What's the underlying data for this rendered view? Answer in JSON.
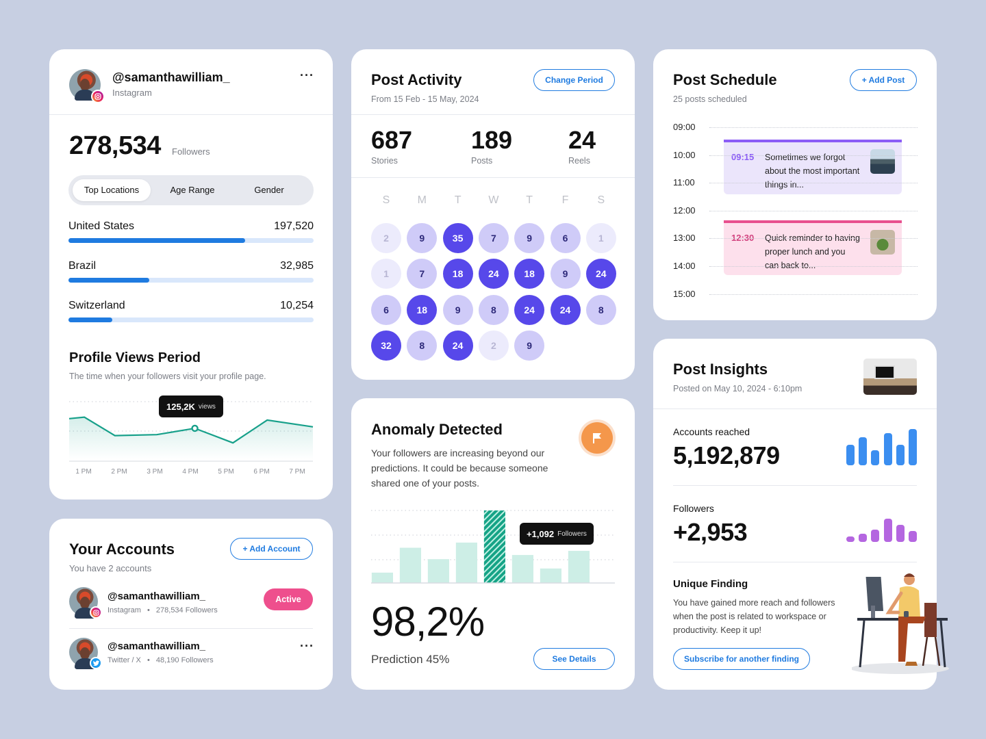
{
  "profile": {
    "handle": "@samanthawilliam_",
    "platform": "Instagram",
    "followers_count": "278,534",
    "followers_label": "Followers",
    "tabs": [
      "Top Locations",
      "Age Range",
      "Gender"
    ],
    "active_tab": "Top Locations",
    "locations": [
      {
        "name": "United States",
        "value": "197,520",
        "fraction": 0.72
      },
      {
        "name": "Brazil",
        "value": "32,985",
        "fraction": 0.33
      },
      {
        "name": "Switzerland",
        "value": "10,254",
        "fraction": 0.18
      }
    ]
  },
  "profile_views": {
    "title": "Profile Views Period",
    "subtitle": "The time when your followers visit your profile page.",
    "tooltip_value": "125,2K",
    "tooltip_unit": "views",
    "accent": "#17a08a"
  },
  "chart_data": [
    {
      "type": "area",
      "title": "Profile Views Period",
      "categories": [
        "1 PM",
        "2 PM",
        "3 PM",
        "4 PM",
        "5 PM",
        "6 PM",
        "7 PM"
      ],
      "x": [
        0.6,
        1,
        1.8,
        2.9,
        3.9,
        4.9,
        5.8,
        7
      ],
      "values": [
        145,
        148,
        110,
        112,
        125,
        95,
        142,
        128
      ],
      "highlight": {
        "category": "4 PM",
        "label": "125,2K views"
      },
      "ylim": [
        60,
        180
      ],
      "grid": true
    },
    {
      "type": "bar",
      "title": "Anomaly Detected",
      "values": [
        10,
        34,
        23,
        39,
        70,
        27,
        14,
        31
      ],
      "highlight_index": 4,
      "highlight_label": "+1,092 Followers",
      "ylim": [
        0,
        70
      ],
      "grid": true
    },
    {
      "type": "bar",
      "title": "Accounts reached",
      "values": [
        55,
        75,
        40,
        85,
        55,
        97
      ]
    },
    {
      "type": "bar",
      "title": "Followers",
      "values": [
        15,
        22,
        32,
        62,
        46,
        30
      ]
    }
  ],
  "accounts": {
    "title": "Your Accounts",
    "subtitle": "You have 2 accounts",
    "add_label": "+ Add Account",
    "list": [
      {
        "handle": "@samanthawilliam_",
        "platform": "Instagram",
        "followers": "278,534 Followers",
        "status": "Active"
      },
      {
        "handle": "@samanthawilliam_",
        "platform": "Twitter / X",
        "followers": "48,190 Followers"
      }
    ]
  },
  "activity": {
    "title": "Post Activity",
    "range": "From 15 Feb - 15 May, 2024",
    "button": "Change Period",
    "stats": [
      {
        "value": "687",
        "label": "Stories"
      },
      {
        "value": "189",
        "label": "Posts"
      },
      {
        "value": "24",
        "label": "Reels"
      }
    ],
    "weekdays": [
      "S",
      "M",
      "T",
      "W",
      "T",
      "F",
      "S"
    ],
    "weeks": [
      [
        2,
        9,
        35,
        7,
        9,
        6,
        1
      ],
      [
        1,
        7,
        18,
        24,
        18,
        9,
        24
      ],
      [
        6,
        18,
        9,
        8,
        24,
        24,
        8
      ],
      [
        32,
        8,
        24,
        2,
        9
      ]
    ]
  },
  "anomaly": {
    "title": "Anomaly Detected",
    "description": "Your followers are increasing beyond our predictions. It could be because someone shared one of your posts.",
    "tooltip_value": "+1,092",
    "tooltip_unit": "Followers",
    "big_value": "98,2%",
    "prediction": "Prediction 45%",
    "button": "See Details"
  },
  "schedule": {
    "title": "Post Schedule",
    "subtitle": "25 posts scheduled",
    "button": "+ Add Post",
    "times": [
      "09:00",
      "10:00",
      "11:00",
      "12:00",
      "13:00",
      "14:00",
      "15:00"
    ],
    "events": [
      {
        "time": "09:15",
        "text": "Sometimes we forgot about the most important things in...",
        "color": "#8b5cf6"
      },
      {
        "time": "12:30",
        "text": "Quick reminder to having proper lunch and you can back to...",
        "color": "#e8508e"
      }
    ]
  },
  "insights": {
    "title": "Post Insights",
    "posted": "Posted on May 10, 2024 - 6:10pm",
    "reached_label": "Accounts reached",
    "reached_value": "5,192,879",
    "followers_label": "Followers",
    "followers_value": "+2,953",
    "finding_title": "Unique Finding",
    "finding_text": "You have gained more reach and followers when the post is related to workspace or productivity. Keep it up!",
    "finding_button": "Subscribe for another finding"
  }
}
